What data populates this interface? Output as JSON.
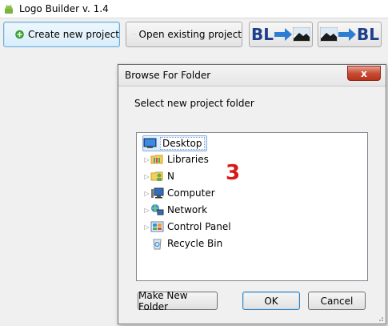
{
  "app": {
    "title": "Logo Builder v. 1.4"
  },
  "toolbar": {
    "create_label": "Create new project",
    "open_label": "Open existing project",
    "bl_to_image_text": "BL",
    "image_to_bl_text": "BL"
  },
  "dialog": {
    "title": "Browse For Folder",
    "close_glyph": "x",
    "prompt": "Select new project folder",
    "annotation": "3",
    "tree": [
      {
        "label": "Desktop",
        "icon": "desktop-icon",
        "expandable": false,
        "selected": true
      },
      {
        "label": "Libraries",
        "icon": "libraries-folder-icon",
        "expandable": true
      },
      {
        "label": "N",
        "icon": "user-folder-icon",
        "expandable": true
      },
      {
        "label": "Computer",
        "icon": "computer-icon",
        "expandable": true
      },
      {
        "label": "Network",
        "icon": "network-icon",
        "expandable": true
      },
      {
        "label": "Control Panel",
        "icon": "control-panel-icon",
        "expandable": true
      },
      {
        "label": "Recycle Bin",
        "icon": "recycle-bin-icon",
        "expandable": false
      }
    ],
    "buttons": {
      "make_folder": "Make New Folder",
      "ok": "OK",
      "cancel": "Cancel"
    }
  },
  "colors": {
    "accent_green": "#3aa832",
    "accent_yellow": "#f5c400",
    "bl_blue": "#1e3f8a",
    "arrow_blue": "#2a7fd4",
    "annotation_red": "#d91818"
  }
}
